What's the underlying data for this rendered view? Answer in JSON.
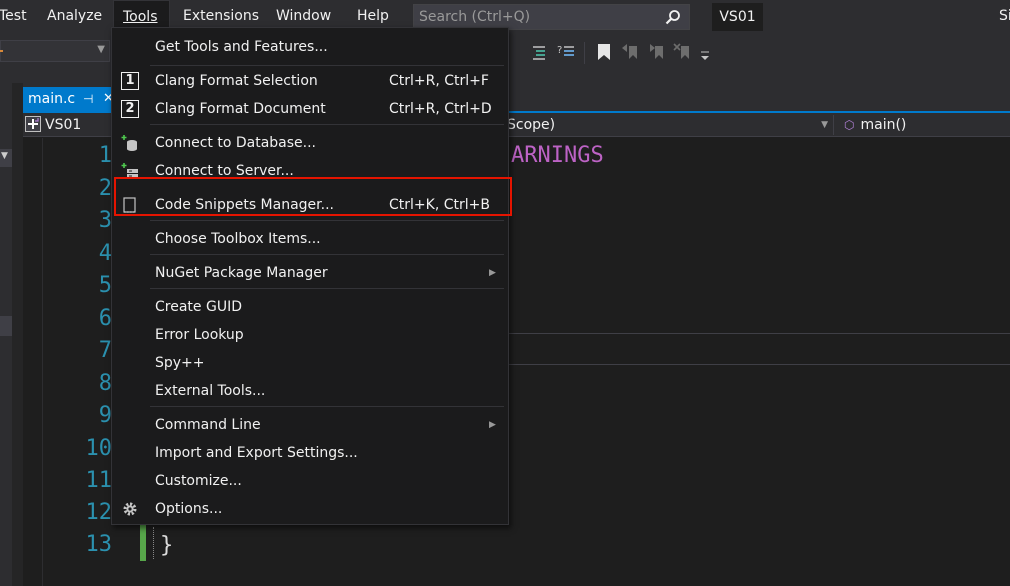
{
  "menubar": {
    "items": [
      "Test",
      "Analyze",
      "Tools",
      "Extensions",
      "Window",
      "Help"
    ],
    "search_placeholder": "Search (Ctrl+Q)",
    "solution_name": "VS01",
    "edge_text": "Si"
  },
  "tab": {
    "filename": "main.c",
    "pin_glyph": "⊣",
    "close_glyph": "✕"
  },
  "navbar": {
    "project": "VS01",
    "scope": "Scope)",
    "function": "main()"
  },
  "editor": {
    "line_numbers": [
      "1",
      "2",
      "3",
      "4",
      "5",
      "6",
      "7",
      "8",
      "9",
      "10",
      "11",
      "12",
      "13"
    ],
    "visible_code_fragment": "ARNINGS",
    "closing_brace": "}"
  },
  "tools_menu": {
    "items": [
      {
        "label": "Get Tools and Features...",
        "shortcut": "",
        "icon": ""
      },
      {
        "label": "Clang Format Selection",
        "shortcut": "Ctrl+R, Ctrl+F",
        "icon": "number-1-icon"
      },
      {
        "label": "Clang Format Document",
        "shortcut": "Ctrl+R, Ctrl+D",
        "icon": "number-2-icon"
      },
      {
        "label": "Connect to Database...",
        "shortcut": "",
        "icon": "database-plus-icon"
      },
      {
        "label": "Connect to Server...",
        "shortcut": "",
        "icon": "server-plus-icon"
      },
      {
        "label": "Code Snippets Manager...",
        "shortcut": "Ctrl+K, Ctrl+B",
        "icon": "snippet-icon"
      },
      {
        "label": "Choose Toolbox Items...",
        "shortcut": "",
        "icon": ""
      },
      {
        "label": "NuGet Package Manager",
        "shortcut": "",
        "icon": "",
        "submenu": true
      },
      {
        "label": "Create GUID",
        "shortcut": "",
        "icon": ""
      },
      {
        "label": "Error Lookup",
        "shortcut": "",
        "icon": ""
      },
      {
        "label": "Spy++",
        "shortcut": "",
        "icon": ""
      },
      {
        "label": "External Tools...",
        "shortcut": "",
        "icon": ""
      },
      {
        "label": "Command Line",
        "shortcut": "",
        "icon": "",
        "submenu": true
      },
      {
        "label": "Import and Export Settings...",
        "shortcut": "",
        "icon": ""
      },
      {
        "label": "Customize...",
        "shortcut": "",
        "icon": ""
      },
      {
        "label": "Options...",
        "shortcut": "",
        "icon": "gear-icon"
      }
    ],
    "icon_number_1": "1",
    "icon_number_2": "2",
    "submenu_arrow": "▶"
  },
  "colors": {
    "accent": "#007acc",
    "highlight_box": "#e51400",
    "line_number": "#2b91af",
    "macro_text": "#bd63c5"
  }
}
